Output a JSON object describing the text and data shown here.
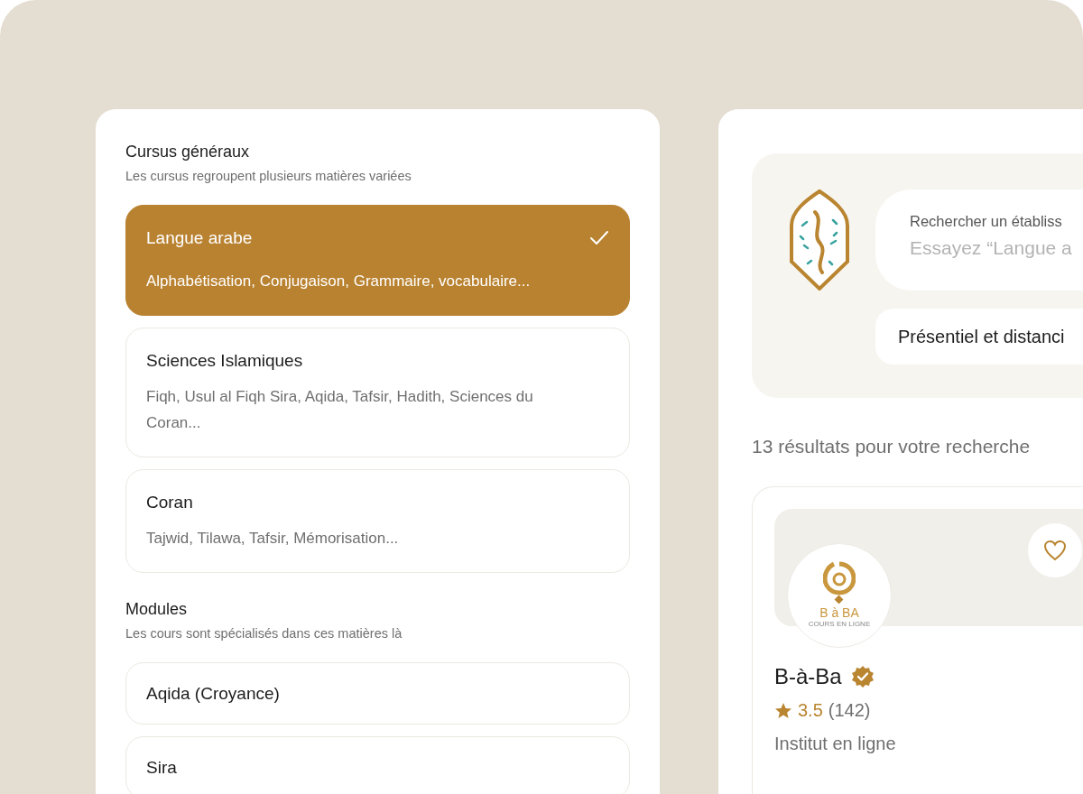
{
  "sections": [
    {
      "title": "Cursus généraux",
      "subtitle": "Les cursus regroupent plusieurs matières variées",
      "items": [
        {
          "title": "Langue arabe",
          "description": "Alphabétisation, Conjugaison, Grammaire, vocabulaire...",
          "selected": true
        },
        {
          "title": "Sciences Islamiques",
          "description": "Fiqh, Usul al Fiqh Sira, Aqida, Tafsir, Hadith, Sciences du Coran...",
          "selected": false
        },
        {
          "title": "Coran",
          "description": "Tajwid, Tilawa, Tafsir, Mémorisation...",
          "selected": false
        }
      ]
    },
    {
      "title": "Modules",
      "subtitle": "Les cours sont spécialisés dans ces matières là",
      "items": [
        {
          "title": "Aqida (Croyance)",
          "selected": false
        },
        {
          "title": "Sira",
          "selected": false
        }
      ]
    }
  ],
  "search": {
    "label": "Rechercher un établiss",
    "placeholder": "Essayez “Langue a",
    "mode": "Présentiel et distanci"
  },
  "results_count": "13 résultats pour votre recherche",
  "result": {
    "logo_text": "B à BA",
    "logo_subtitle": "COURS EN LIGNE",
    "name": "B-à-Ba",
    "verified": true,
    "favorite": false,
    "rating": "3.5",
    "reviews": "(142)",
    "type": "Institut en ligne"
  }
}
